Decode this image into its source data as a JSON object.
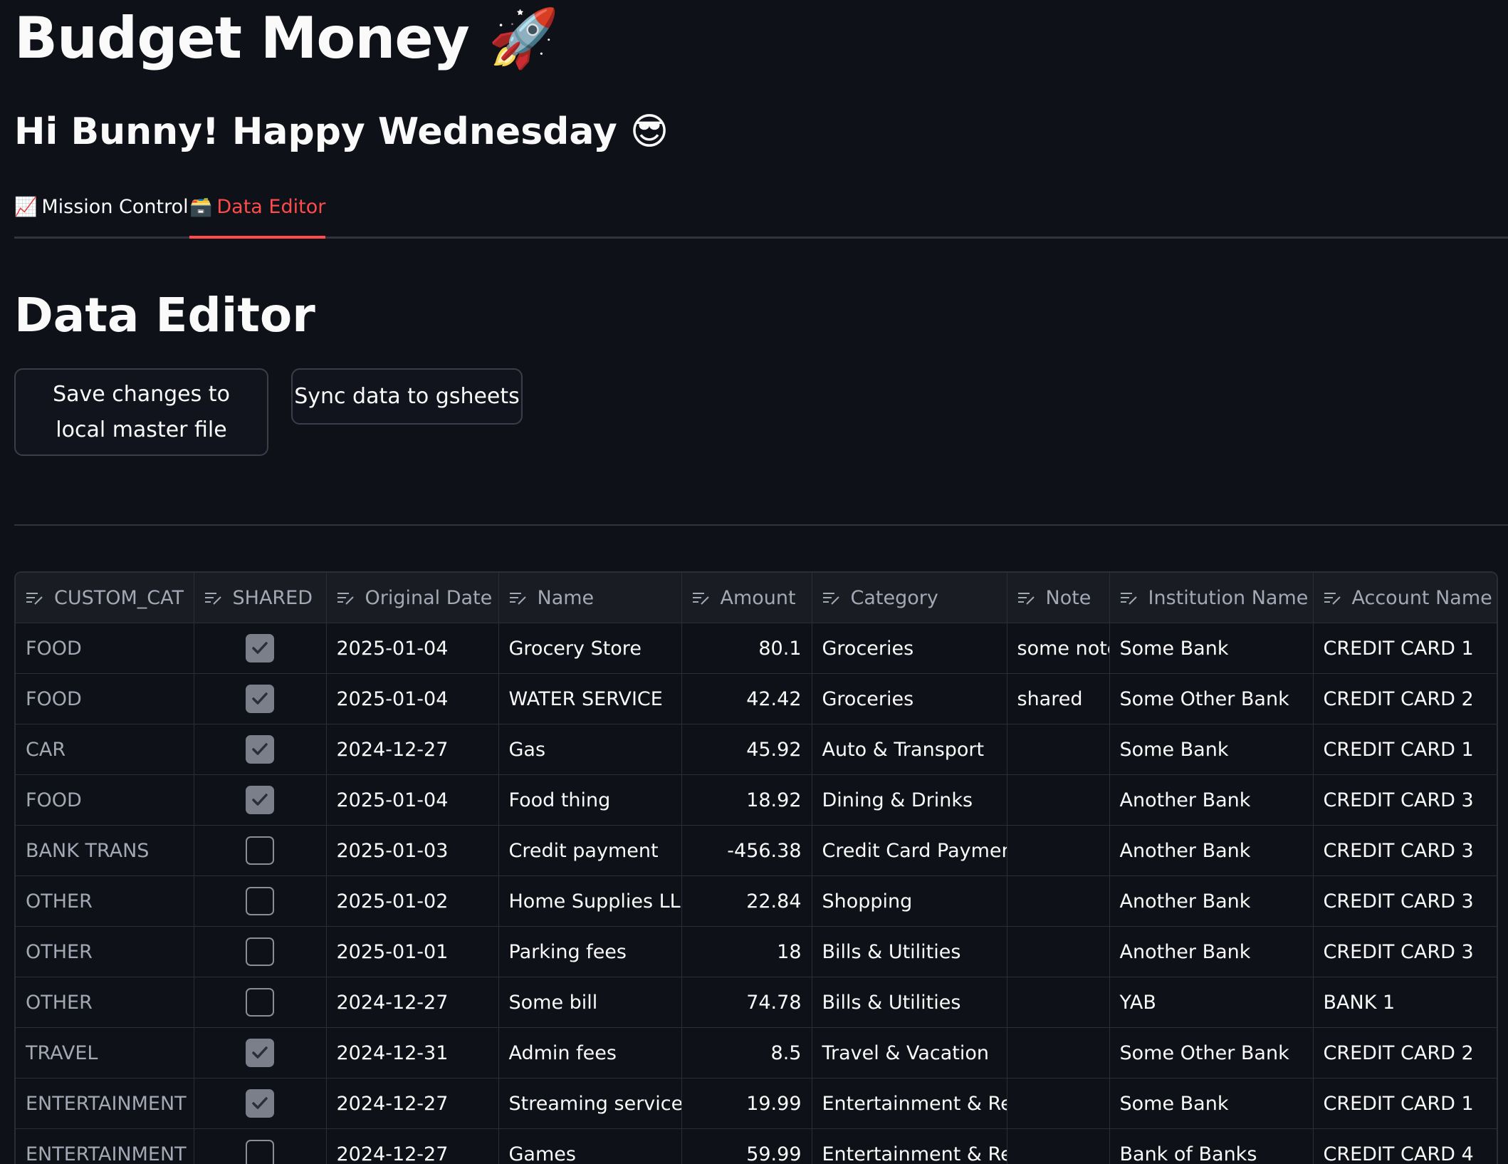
{
  "app": {
    "title": "Budget Money 🚀",
    "greeting": "Hi Bunny! Happy Wednesday 😎"
  },
  "tabs": [
    {
      "icon": "📈",
      "label": "Mission Control",
      "active": false
    },
    {
      "icon": "🗃️",
      "label": "Data Editor",
      "active": true
    }
  ],
  "section": {
    "title": "Data Editor"
  },
  "buttons": {
    "save_label": "Save changes to local master file",
    "sync_label": "Sync data to gsheets"
  },
  "table": {
    "columns": [
      "CUSTOM_CAT",
      "SHARED",
      "Original Date",
      "Name",
      "Amount",
      "Category",
      "Note",
      "Institution Name",
      "Account Name"
    ],
    "rows": [
      {
        "custom_cat": "FOOD",
        "shared": true,
        "date": "2025-01-04",
        "name": "Grocery Store",
        "amount": "80.1",
        "category": "Groceries",
        "note": "some note",
        "institution": "Some Bank",
        "account": "CREDIT CARD 1"
      },
      {
        "custom_cat": "FOOD",
        "shared": true,
        "date": "2025-01-04",
        "name": "WATER SERVICE",
        "amount": "42.42",
        "category": "Groceries",
        "note": "shared",
        "institution": "Some Other Bank",
        "account": "CREDIT CARD 2"
      },
      {
        "custom_cat": "CAR",
        "shared": true,
        "date": "2024-12-27",
        "name": "Gas",
        "amount": "45.92",
        "category": "Auto & Transport",
        "note": "",
        "institution": "Some Bank",
        "account": "CREDIT CARD 1"
      },
      {
        "custom_cat": "FOOD",
        "shared": true,
        "date": "2025-01-04",
        "name": "Food thing",
        "amount": "18.92",
        "category": "Dining & Drinks",
        "note": "",
        "institution": "Another Bank",
        "account": "CREDIT CARD 3"
      },
      {
        "custom_cat": "BANK TRANS",
        "shared": false,
        "date": "2025-01-03",
        "name": "Credit payment",
        "amount": "-456.38",
        "category": "Credit Card Payment",
        "note": "",
        "institution": "Another Bank",
        "account": "CREDIT CARD 3"
      },
      {
        "custom_cat": "OTHER",
        "shared": false,
        "date": "2025-01-02",
        "name": "Home Supplies LLC",
        "amount": "22.84",
        "category": "Shopping",
        "note": "",
        "institution": "Another Bank",
        "account": "CREDIT CARD 3"
      },
      {
        "custom_cat": "OTHER",
        "shared": false,
        "date": "2025-01-01",
        "name": "Parking fees",
        "amount": "18",
        "category": "Bills & Utilities",
        "note": "",
        "institution": "Another Bank",
        "account": "CREDIT CARD 3"
      },
      {
        "custom_cat": "OTHER",
        "shared": false,
        "date": "2024-12-27",
        "name": "Some bill",
        "amount": "74.78",
        "category": "Bills & Utilities",
        "note": "",
        "institution": "YAB",
        "account": "BANK 1"
      },
      {
        "custom_cat": "TRAVEL",
        "shared": true,
        "date": "2024-12-31",
        "name": "Admin fees",
        "amount": "8.5",
        "category": "Travel & Vacation",
        "note": "",
        "institution": "Some Other Bank",
        "account": "CREDIT CARD 2"
      },
      {
        "custom_cat": "ENTERTAINMENT",
        "shared": true,
        "date": "2024-12-27",
        "name": "Streaming services",
        "amount": "19.99",
        "category": "Entertainment & Rec.",
        "note": "",
        "institution": "Some Bank",
        "account": "CREDIT CARD 1"
      },
      {
        "custom_cat": "ENTERTAINMENT",
        "shared": false,
        "date": "2024-12-27",
        "name": "Games",
        "amount": "59.99",
        "category": "Entertainment & Rec.",
        "note": "",
        "institution": "Bank of Banks",
        "account": "CREDIT CARD 4"
      }
    ]
  },
  "colors": {
    "background": "#0e1117",
    "accent": "#ff4b4b",
    "checkbox_checked": "#7b7f89"
  }
}
